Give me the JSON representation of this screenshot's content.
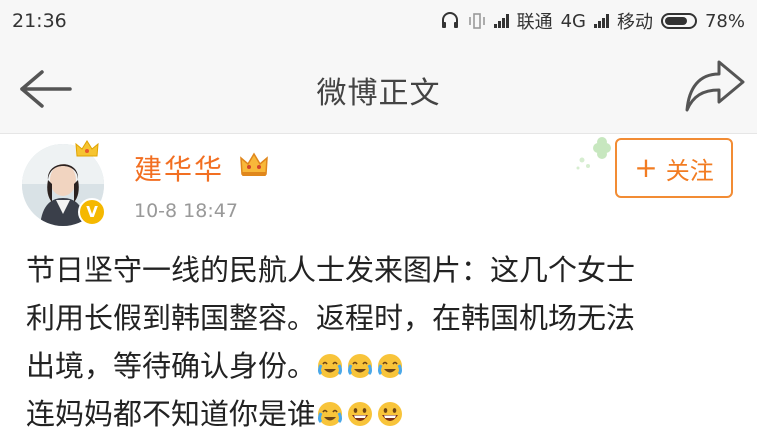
{
  "status_bar": {
    "time": "21:36",
    "carrier1": "联通",
    "network": "4G",
    "carrier2": "移动",
    "battery": "78%",
    "battery_level": 0.78,
    "icons": [
      "headset-icon",
      "vibrate-icon",
      "signal-icon",
      "signal-icon",
      "battery-icon"
    ]
  },
  "nav": {
    "title": "微博正文",
    "back_icon": "back-arrow-icon",
    "share_icon": "share-arrow-icon"
  },
  "post": {
    "username": "建华华",
    "time": "10-8 18:47",
    "verified_mark": "V",
    "follow_label": "关注",
    "follow_plus": "+",
    "text_lines": [
      "节日坚守一线的民航人士发来图片：这几个女士",
      "利用长假到韩国整容。返程时，在韩国机场无法",
      "出境，等待确认身份。",
      "连妈妈都不知道你是谁"
    ],
    "line3_emojis": [
      "crying-laugh-emoji",
      "crying-laugh-emoji",
      "crying-laugh-emoji"
    ],
    "line4_emojis": [
      "crying-laugh-emoji",
      "grin-emoji",
      "grin-emoji"
    ]
  },
  "colors": {
    "username": "#f26f22",
    "follow": "#f27c22",
    "verified": "#f5b800",
    "bar_bg": "#f7f7f7"
  }
}
